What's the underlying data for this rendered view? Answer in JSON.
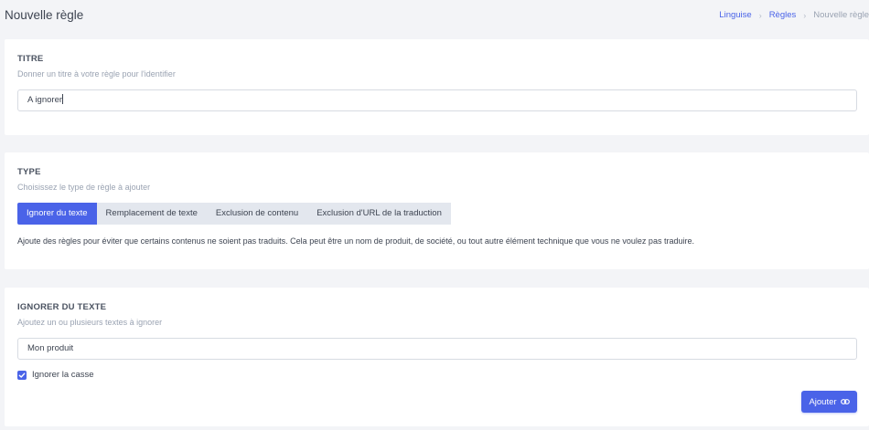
{
  "header": {
    "title": "Nouvelle règle",
    "breadcrumb": [
      "Linguise",
      "Règles",
      "Nouvelle règle"
    ],
    "separator": "›"
  },
  "title_section": {
    "heading": "TITRE",
    "subtitle": "Donner un titre à votre règle pour l'identifier",
    "value": "A ignorer"
  },
  "type_section": {
    "heading": "TYPE",
    "subtitle": "Choisissez le type de règle à ajouter",
    "tabs": [
      {
        "label": "Ignorer du texte",
        "active": true
      },
      {
        "label": "Remplacement de texte",
        "active": false
      },
      {
        "label": "Exclusion de contenu",
        "active": false
      },
      {
        "label": "Exclusion d'URL de la traduction",
        "active": false
      }
    ],
    "description": "Ajoute des règles pour éviter que certains contenus ne soient pas traduits. Cela peut être un nom de produit, de société, ou tout autre élément technique que vous ne voulez pas traduire."
  },
  "ignore_section": {
    "heading": "IGNORER DU TEXTE",
    "subtitle": "Ajoutez un ou plusieurs textes à ignorer",
    "value": "Mon produit",
    "checkbox_label": "Ignorer la casse",
    "checkbox_checked": true,
    "add_label": "Ajouter"
  },
  "colors": {
    "accent": "#4a63e8",
    "background": "#f3f4f7",
    "card": "#ffffff",
    "tab_inactive": "#e3e7ee"
  },
  "icons": {
    "checkbox": "check-icon",
    "add_button": "link-icon",
    "breadcrumb_separator": "chevron-right-icon"
  }
}
